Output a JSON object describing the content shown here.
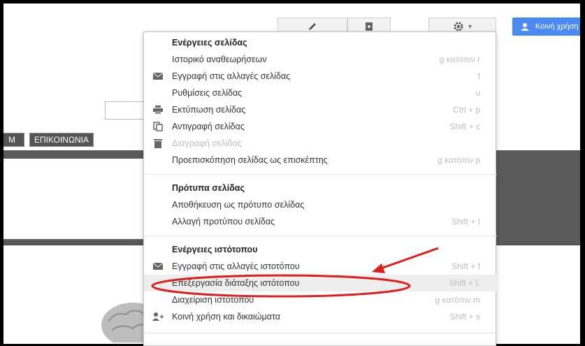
{
  "toolbar": {
    "edit_icon": "pencil-icon",
    "newpage_icon": "new-page-icon",
    "settings_icon": "gear-icon",
    "settings_caret": "▾",
    "share_label": "Κοινή χρήση",
    "share_icon": "people-icon"
  },
  "nav": {
    "tab_partial": "Μ",
    "tab_contact": "ΕΠΙΚΟΙΝΩΝΙΑ"
  },
  "menu": {
    "section1": {
      "header": "Ενέργειες σελίδας",
      "items": [
        {
          "label": "Ιστορικό αναθεωρήσεων",
          "shortcut": "g κατόπιν r",
          "icon": ""
        },
        {
          "label": "Εγγραφή στις αλλαγές σελίδας",
          "shortcut": "f",
          "icon": "envelope-icon"
        },
        {
          "label": "Ρυθμίσεις σελίδας",
          "shortcut": "u",
          "icon": ""
        },
        {
          "label": "Εκτύπωση σελίδας",
          "shortcut": "Ctrl + p",
          "icon": "printer-icon"
        },
        {
          "label": "Αντιγραφή σελίδας",
          "shortcut": "Shift + c",
          "icon": "copy-icon"
        },
        {
          "label": "Διαγραφή σελίδας",
          "shortcut": "",
          "icon": "trash-icon",
          "disabled": true
        },
        {
          "label": "Προεπισκόπηση σελίδας ως επισκέπτης",
          "shortcut": "g κατόπιν p",
          "icon": ""
        }
      ]
    },
    "section2": {
      "header": "Πρότυπα σελίδας",
      "items": [
        {
          "label": "Αποθήκευση ως πρότυπο σελίδας",
          "shortcut": ""
        },
        {
          "label": "Αλλαγή προτύπου σελίδας",
          "shortcut": "Shift + t"
        }
      ]
    },
    "section3": {
      "header": "Ενέργειες ιστότοπου",
      "items": [
        {
          "label": "Εγγραφή στις αλλαγές ιστοτόπου",
          "shortcut": "Shift + f",
          "icon": "envelope-icon"
        },
        {
          "label": "Επεξεργασία διάταξης ιστότοπου",
          "shortcut": "Shift + L",
          "icon": "",
          "highlighted": true
        },
        {
          "label": "Διαχείριση ιστότοπου",
          "shortcut": "g κατόπιν m",
          "icon": ""
        },
        {
          "label": "Κοινή χρήση και δικαιώματα",
          "shortcut": "Shift + s",
          "icon": "add-person-icon"
        }
      ]
    }
  },
  "annotation": {
    "arrow_color": "#e21b1b",
    "ellipse_color": "#e21b1b"
  }
}
